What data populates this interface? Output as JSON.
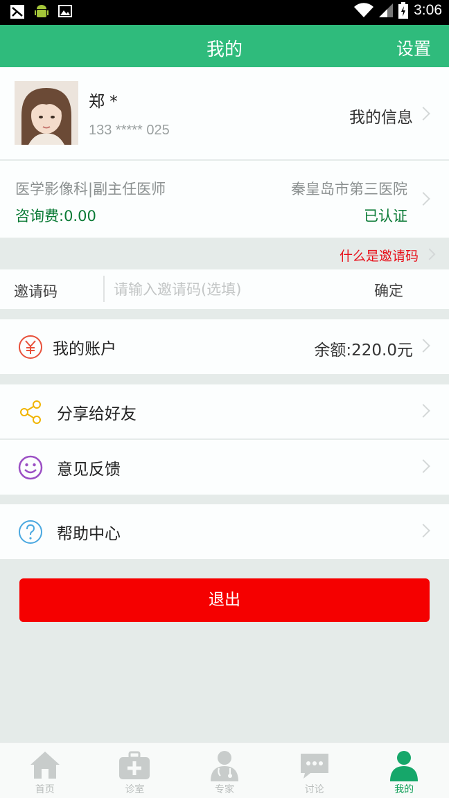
{
  "status_bar": {
    "time": "3:06"
  },
  "header": {
    "title": "我的",
    "settings_label": "设置"
  },
  "profile": {
    "name": "郑 *",
    "phone": "133 ***** 025",
    "my_info_label": "我的信息"
  },
  "doctor": {
    "department": "医学影像科|副主任医师",
    "hospital": "秦皇岛市第三医院",
    "fee": "咨询费:0.00",
    "verified": "已认证"
  },
  "invite": {
    "tip": "什么是邀请码",
    "label": "邀请码",
    "placeholder": "请输入邀请码(选填)",
    "value": "",
    "confirm_label": "确定"
  },
  "account": {
    "label": "我的账户",
    "balance": "余额:220.0元"
  },
  "menu": {
    "share_label": "分享给好友",
    "feedback_label": "意见反馈",
    "help_label": "帮助中心"
  },
  "logout_label": "退出",
  "tabs": [
    {
      "label": "首页",
      "icon": "home-icon"
    },
    {
      "label": "诊室",
      "icon": "medical-kit-icon"
    },
    {
      "label": "专家",
      "icon": "doctor-icon"
    },
    {
      "label": "讨论",
      "icon": "chat-bubble-icon"
    },
    {
      "label": "我的",
      "icon": "user-icon",
      "active": true
    }
  ],
  "colors": {
    "brand_green": "#2fbb7c",
    "logout_red": "#f50000",
    "invite_tip_red": "#e8101a",
    "verified_green": "#0a7a35",
    "active_tab_green": "#13a05a"
  }
}
